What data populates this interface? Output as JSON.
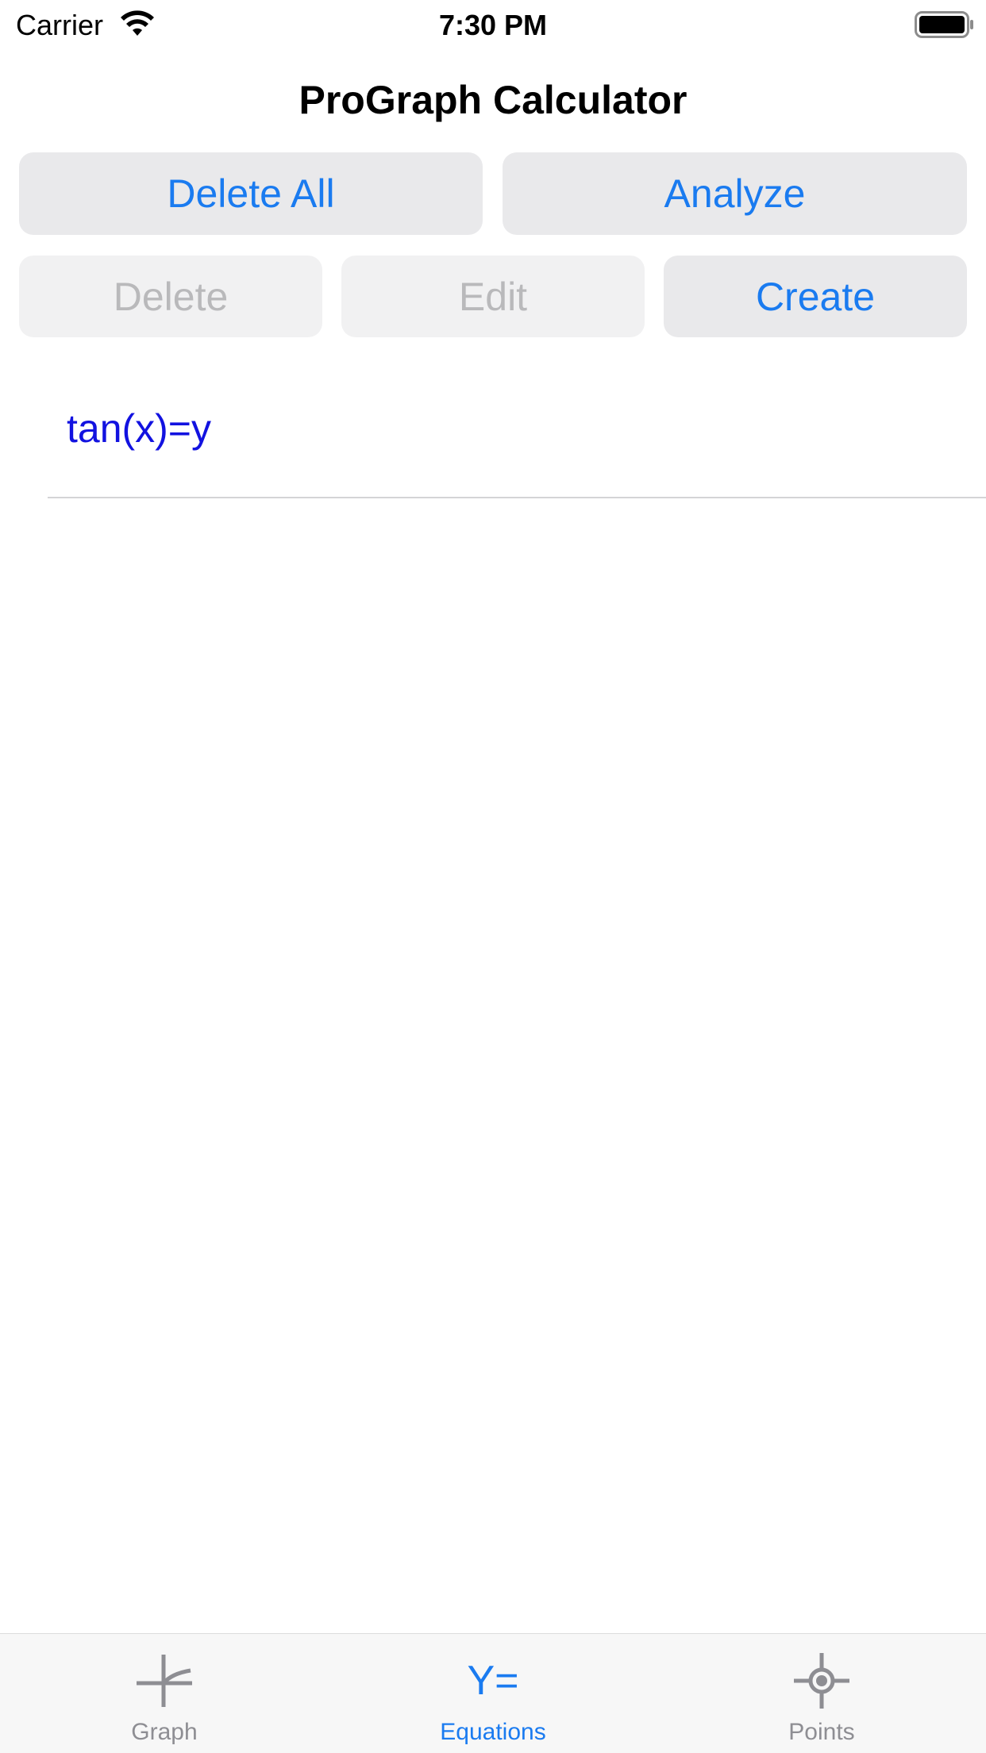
{
  "status_bar": {
    "carrier": "Carrier",
    "time": "7:30 PM",
    "wifi_icon": "wifi-icon",
    "battery_icon": "battery-icon"
  },
  "header": {
    "title": "ProGraph Calculator"
  },
  "toolbar": {
    "delete_all_label": "Delete All",
    "analyze_label": "Analyze",
    "delete_label": "Delete",
    "edit_label": "Edit",
    "create_label": "Create",
    "delete_enabled": false,
    "edit_enabled": false
  },
  "equations": [
    {
      "text": "tan(x)=y",
      "color": "#1212e0"
    }
  ],
  "tab_bar": {
    "selected": "Equations",
    "tabs": [
      {
        "label": "Graph",
        "icon": "graph-axes-icon"
      },
      {
        "label": "Equations",
        "icon": "y-equals-icon",
        "glyph": "Y="
      },
      {
        "label": "Points",
        "icon": "crosshair-point-icon"
      }
    ]
  },
  "colors": {
    "accent": "#1a7bf0",
    "button_bg": "#e9e9eb",
    "disabled_text": "#b9b9bb",
    "inactive_tab": "#8e8e93"
  }
}
